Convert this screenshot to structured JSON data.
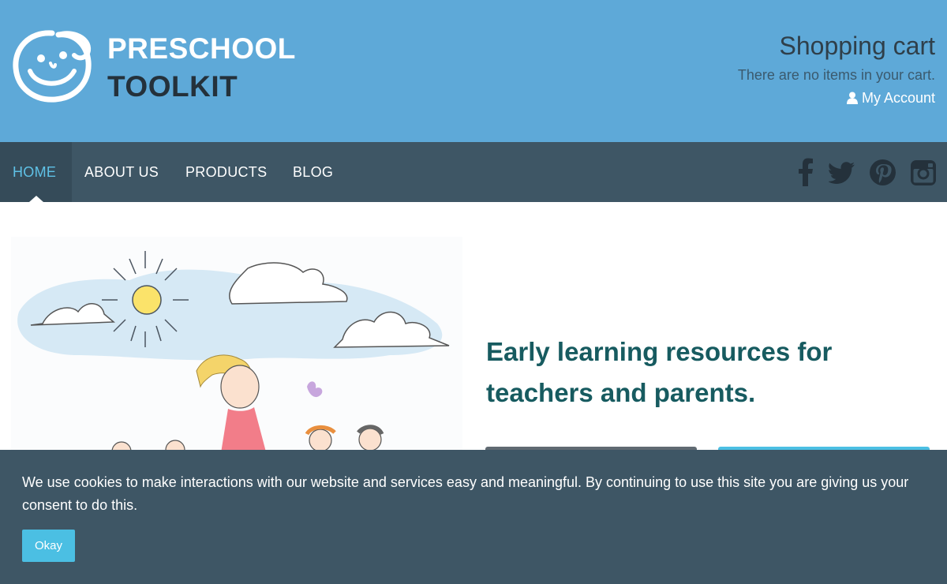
{
  "header": {
    "brand_line1": "PRESCHOOL",
    "brand_line2": "TOOLKIT",
    "cart_title": "Shopping cart",
    "cart_status": "There are no items in your cart.",
    "account_label": "My Account"
  },
  "nav": {
    "items": [
      {
        "label": "HOME",
        "active": true
      },
      {
        "label": "ABOUT US",
        "active": false
      },
      {
        "label": "PRODUCTS",
        "active": false
      },
      {
        "label": "BLOG",
        "active": false
      }
    ],
    "social_icons": [
      "facebook-icon",
      "twitter-icon",
      "pinterest-icon",
      "instagram-icon"
    ]
  },
  "hero": {
    "tagline": "Early learning resources for teachers and parents."
  },
  "cookie": {
    "message": "We use cookies to make interactions with our website and services easy and meaningful. By continuing to use this site you are giving us your consent to do this.",
    "button_label": "Okay"
  },
  "colors": {
    "header_bg": "#5ea9d8",
    "nav_bg": "#3e5665",
    "accent": "#4bbfe3",
    "tagline": "#175b60"
  }
}
